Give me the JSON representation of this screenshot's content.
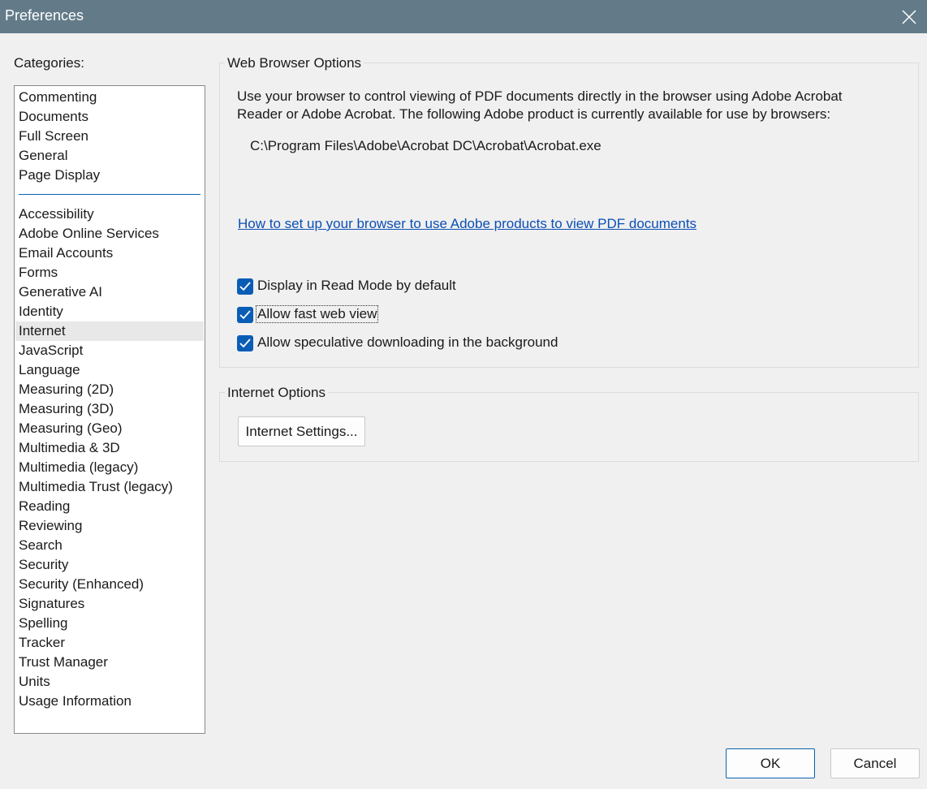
{
  "window": {
    "title": "Preferences",
    "close_icon": "close-icon"
  },
  "categories": {
    "label": "Categories:",
    "top_items": [
      "Commenting",
      "Documents",
      "Full Screen",
      "General",
      "Page Display"
    ],
    "items": [
      "Accessibility",
      "Adobe Online Services",
      "Email Accounts",
      "Forms",
      "Generative AI",
      "Identity",
      "Internet",
      "JavaScript",
      "Language",
      "Measuring (2D)",
      "Measuring (3D)",
      "Measuring (Geo)",
      "Multimedia & 3D",
      "Multimedia (legacy)",
      "Multimedia Trust (legacy)",
      "Reading",
      "Reviewing",
      "Search",
      "Security",
      "Security (Enhanced)",
      "Signatures",
      "Spelling",
      "Tracker",
      "Trust Manager",
      "Units",
      "Usage Information"
    ],
    "selected": "Internet"
  },
  "web_browser_options": {
    "title": "Web Browser Options",
    "description": "Use your browser to control viewing of PDF documents directly in the browser using Adobe Acrobat Reader or Adobe Acrobat. The following Adobe product is currently available for use by browsers:",
    "product_path": "C:\\Program Files\\Adobe\\Acrobat DC\\Acrobat\\Acrobat.exe",
    "help_link": "How to set up your browser to use Adobe products to view PDF documents",
    "checkboxes": [
      {
        "label": "Display in Read Mode by default",
        "checked": true
      },
      {
        "label": "Allow fast web view",
        "checked": true
      },
      {
        "label": "Allow speculative downloading in the background",
        "checked": true
      }
    ]
  },
  "internet_options": {
    "title": "Internet Options",
    "settings_button": "Internet Settings..."
  },
  "footer": {
    "ok_label": "OK",
    "cancel_label": "Cancel"
  },
  "colors": {
    "titlebar": "#637b89",
    "accent": "#0a5db5",
    "link": "#0b4fb5",
    "selected_row": "#e8e8e8"
  }
}
